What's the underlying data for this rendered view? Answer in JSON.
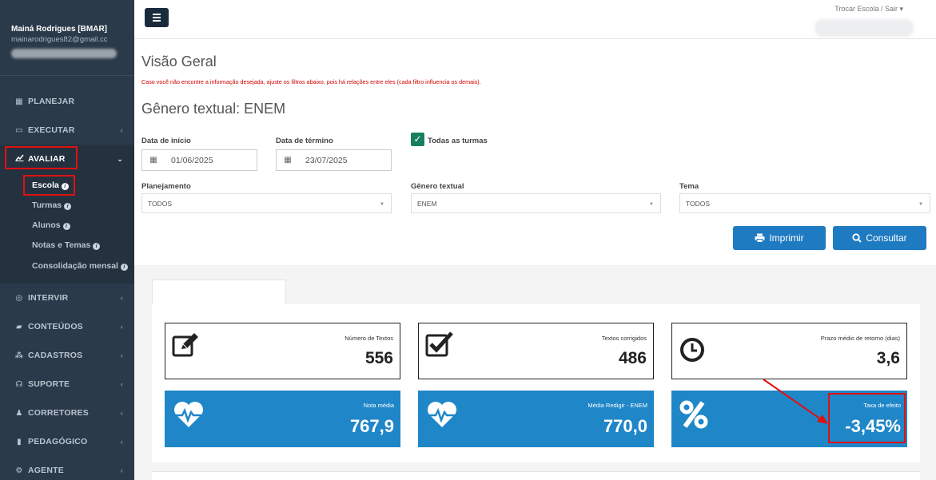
{
  "user": {
    "name": "Mainá Rodrigues [BMAR]",
    "email": "mainarodrigues82@gmail.cc"
  },
  "nav": {
    "planejar": "PLANEJAR",
    "executar": "EXECUTAR",
    "avaliar": "AVALIAR",
    "sub": {
      "escola": "Escola",
      "turmas": "Turmas",
      "alunos": "Alunos",
      "notas": "Notas e Temas",
      "consolidacao": "Consolidação mensal"
    },
    "intervir": "INTERVIR",
    "conteudos": "CONTEÚDOS",
    "cadastros": "CADASTROS",
    "suporte": "SUPORTE",
    "corretores": "CORRETORES",
    "pedagogico": "PEDAGÓGICO",
    "agente": "AGENTE"
  },
  "topbar": {
    "link": "Trocar Escola / Sair ▾"
  },
  "page": {
    "title": "Visão Geral",
    "warning": "Caso você não encontre a informação desejada, ajuste os filtros abaixo, pois há relações entre eles (cada filtro influencia os demais).",
    "subtitle": "Gênero textual: ENEM"
  },
  "filters": {
    "start_label": "Data de início",
    "start_value": "01/06/2025",
    "end_label": "Data de término",
    "end_value": "23/07/2025",
    "all_classes_label": "Todas as turmas",
    "planejamento_label": "Planejamento",
    "planejamento_value": "TODOS",
    "genero_label": "Gênero textual",
    "genero_value": "ENEM",
    "tema_label": "Tema",
    "tema_value": "TODOS",
    "print_label": "Imprimir",
    "consult_label": "Consultar"
  },
  "cards": {
    "textos": {
      "label": "Número de Textos",
      "value": "556"
    },
    "corrigidos": {
      "label": "Textos corrigidos",
      "value": "486"
    },
    "prazo": {
      "label": "Prazo médio de retorno (dias)",
      "value": "3,6"
    },
    "nota": {
      "label": "Nota média",
      "value": "767,9"
    },
    "redigir": {
      "label": "Média Redigir - ENEM",
      "value": "770,0"
    },
    "efeito": {
      "label": "Taxa de efeito",
      "value": "-3,45%"
    }
  },
  "colors": {
    "sidebar": "#2b3a4a",
    "accent": "#1f86c8",
    "highlight": "#e01010",
    "check": "#15805f"
  }
}
